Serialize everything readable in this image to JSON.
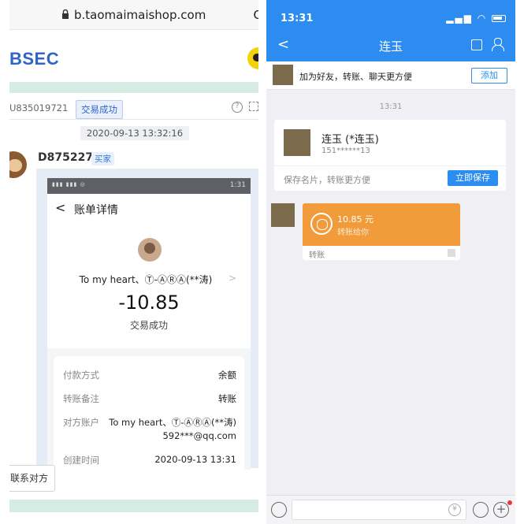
{
  "left": {
    "url": "b.taomaimaishop.com",
    "url_right": "C",
    "brand": "BSEC",
    "order_id": "U835019721",
    "status_badge": "交易成功",
    "help_glyph": "?",
    "timestamp": "2020-09-13 13:32:16",
    "buyer_name": "D875227",
    "buyer_badge": "买家",
    "phone": {
      "status_time": "1:31",
      "title": "账单详情",
      "back": "<",
      "payee": "To my heart、Ⓣ-ⒶⓇⒶ(**涛)",
      "payee_arrow": ">",
      "amount": "-10.85",
      "amount_status": "交易成功",
      "rows": [
        {
          "label": "付款方式",
          "value": "余额"
        },
        {
          "label": "转账备注",
          "value": "转账"
        },
        {
          "label": "对方账户",
          "value": "To my heart、Ⓣ-ⒶⓇⒶ(**涛)",
          "value2": "592***@qq.com"
        },
        {
          "label": "创建时间",
          "value": "2020-09-13 13:31"
        }
      ]
    },
    "contact_button": "联系对方"
  },
  "right": {
    "status_time": "13:31",
    "nav_back": "<",
    "nav_title": "连玉",
    "add_text": "加为好友，转账、聊天更方便",
    "add_button": "添加",
    "chat_time": "13:31",
    "card": {
      "name": "连玉 (*连玉)",
      "phone": "151******13",
      "hint": "保存名片，转账更方便",
      "save_button": "立即保存"
    },
    "message": {
      "amount": "10.85 元",
      "sub": "转账给你",
      "footer": "转账"
    },
    "input": {
      "yen": "¥",
      "plus": "+"
    }
  }
}
